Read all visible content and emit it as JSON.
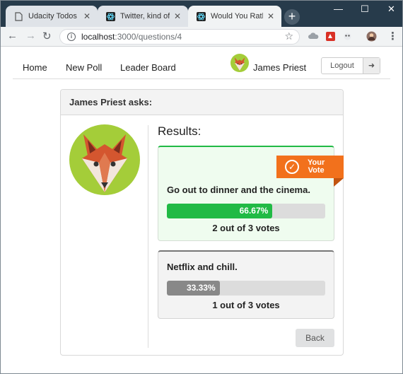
{
  "browser": {
    "tabs": [
      {
        "title": "Udacity Todos Goal",
        "favicon": "document-icon",
        "active": false
      },
      {
        "title": "Twitter, kind of.",
        "favicon": "react-icon",
        "active": false
      },
      {
        "title": "Would You Rather C",
        "favicon": "react-icon",
        "active": true
      }
    ],
    "url_host": "localhost",
    "url_path": ":3000/questions/4",
    "colors": {
      "tabbar": "#273b4b",
      "toolbar": "#f1f3f4"
    }
  },
  "nav": {
    "home": "Home",
    "new_poll": "New Poll",
    "leader_board": "Leader Board",
    "user_name": "James Priest",
    "logout": "Logout"
  },
  "question": {
    "author_header": "James Priest asks:",
    "results_title": "Results:",
    "your_vote_badge_line1": "Your",
    "your_vote_badge_line2": "Vote",
    "options": [
      {
        "text": "Go out to dinner and the cinema.",
        "percent_label": "66.67%",
        "percent": 66.67,
        "votes_text": "2 out of 3 votes",
        "color": "#21ba45",
        "is_user_vote": true
      },
      {
        "text": "Netflix and chill.",
        "percent_label": "33.33%",
        "percent": 33.33,
        "votes_text": "1 out of 3 votes",
        "color": "#888888",
        "is_user_vote": false
      }
    ],
    "back": "Back"
  },
  "colors": {
    "accent_win": "#21ba45",
    "ribbon": "#f2711c"
  }
}
